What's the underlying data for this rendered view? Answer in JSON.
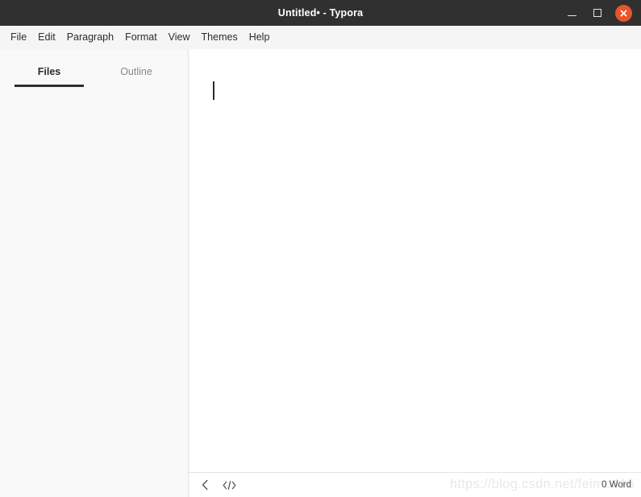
{
  "window": {
    "title": "Untitled• - Typora",
    "controls": {
      "minimize_label": "Minimize",
      "maximize_label": "Maximize",
      "close_label": "Close"
    },
    "colors": {
      "titlebar_bg": "#303030",
      "titlebar_text": "#ffffff",
      "menubar_bg": "#f5f5f5",
      "sidebar_bg": "#f9f9f9",
      "editor_bg": "#ffffff",
      "close_button": "#ec5328",
      "active_tab_underline": "#2e2e2e",
      "border": "#e2e2e2"
    }
  },
  "menu": {
    "items": [
      {
        "label": "File"
      },
      {
        "label": "Edit"
      },
      {
        "label": "Paragraph"
      },
      {
        "label": "Format"
      },
      {
        "label": "View"
      },
      {
        "label": "Themes"
      },
      {
        "label": "Help"
      }
    ]
  },
  "sidebar": {
    "tabs": [
      {
        "label": "Files",
        "active": true
      },
      {
        "label": "Outline",
        "active": false
      }
    ],
    "files": []
  },
  "editor": {
    "content": "",
    "caret_visible": true
  },
  "status_bar": {
    "icons": [
      {
        "name": "chevron-left-icon",
        "glyph": "‹"
      },
      {
        "name": "source-code-icon",
        "glyph": "</>"
      }
    ],
    "word_count": "0 Word"
  },
  "watermark": {
    "text": "https://blog.csdn.net/feimo416"
  }
}
